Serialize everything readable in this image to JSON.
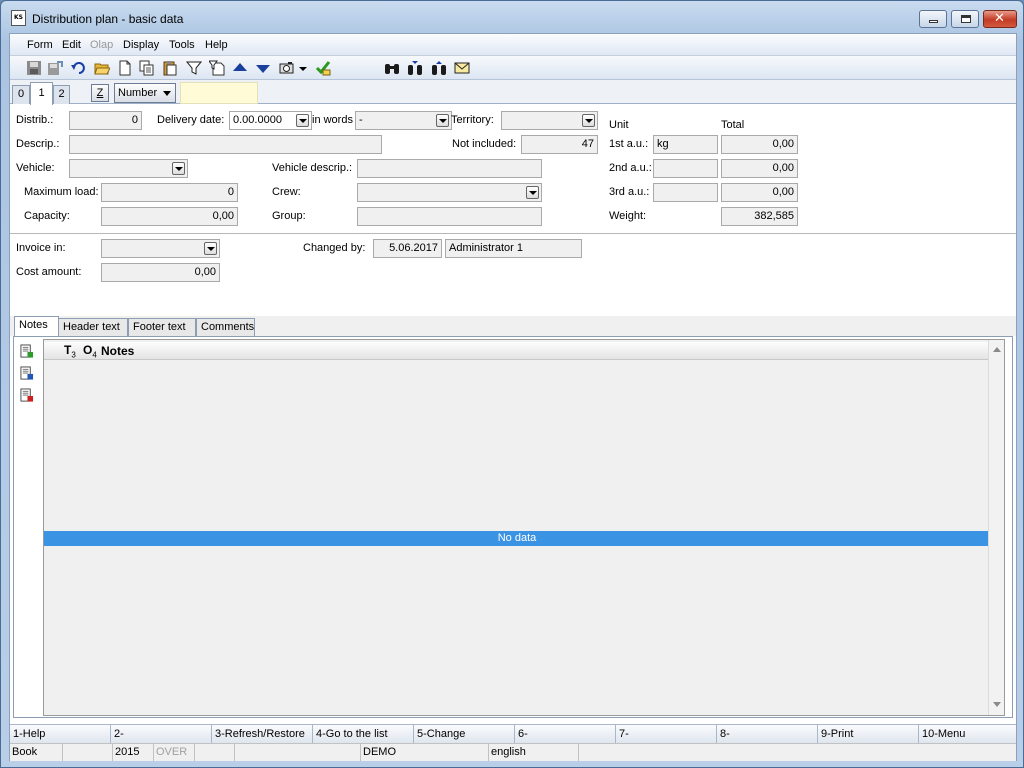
{
  "window": {
    "title": "Distribution plan - basic data",
    "app_icon_text": "KS"
  },
  "menu": [
    {
      "label": "Form",
      "enabled": true
    },
    {
      "label": "Edit",
      "enabled": true
    },
    {
      "label": "Olap",
      "enabled": false
    },
    {
      "label": "Display",
      "enabled": true
    },
    {
      "label": "Tools",
      "enabled": true
    },
    {
      "label": "Help",
      "enabled": true
    }
  ],
  "toolbar_icons": [
    "save-icon",
    "save-as-icon",
    "undo-icon",
    "open-folder-icon",
    "new-document-icon",
    "copy-icon",
    "paste-icon",
    "filter-icon",
    "filter-document-icon",
    "arrow-up-icon",
    "arrow-down-icon",
    "camera-icon",
    "dropdown-icon",
    "check-export-icon",
    "binoculars-icon",
    "binoculars-next-icon",
    "binoculars-prev-icon",
    "envelope-icon"
  ],
  "view_tabs": [
    "0",
    "1",
    "2"
  ],
  "active_view_tab": "1",
  "z_label": "Z",
  "search_mode": "Number",
  "search_value": "",
  "form": {
    "distrib_label": "Distrib.:",
    "distrib_value": "0",
    "delivery_date_label": "Delivery date:",
    "delivery_date_value": "0.00.0000",
    "in_words_label": "in words",
    "in_words_value": "-",
    "territory_label": "Territory:",
    "territory_value": "",
    "descrip_label": "Descrip.:",
    "descrip_value": "",
    "not_included_label": "Not included:",
    "not_included_value": "47",
    "vehicle_label": "Vehicle:",
    "vehicle_value": "",
    "vehicle_descrip_label": "Vehicle descrip.:",
    "vehicle_descrip_value": "",
    "max_load_label": "Maximum load:",
    "max_load_value": "0",
    "crew_label": "Crew:",
    "crew_value": "",
    "capacity_label": "Capacity:",
    "capacity_value": "0,00",
    "group_label": "Group:",
    "group_value": "",
    "unit_header": "Unit",
    "total_header": "Total",
    "au1_label": "1st a.u.:",
    "au1_unit": "kg",
    "au1_total": "0,00",
    "au2_label": "2nd a.u.:",
    "au2_unit": "",
    "au2_total": "0,00",
    "au3_label": "3rd a.u.:",
    "au3_unit": "",
    "au3_total": "0,00",
    "weight_label": "Weight:",
    "weight_value": "382,585",
    "invoice_in_label": "Invoice in:",
    "invoice_in_value": "",
    "cost_amount_label": "Cost amount:",
    "cost_amount_value": "0,00",
    "changed_by_label": "Changed by:",
    "changed_date": "5.06.2017",
    "changed_user": "Administrator 1"
  },
  "notes_tabs": [
    "Notes",
    "Header text",
    "Footer text",
    "Comments"
  ],
  "active_notes_tab": "Notes",
  "grid": {
    "col_icon1": "T",
    "col_sub1": "3",
    "col_icon2": "O",
    "col_sub2": "4",
    "col_notes": "Notes",
    "empty_text": "No data"
  },
  "side_icons": [
    "add-row-icon",
    "edit-row-icon",
    "delete-row-icon"
  ],
  "function_keys": [
    "1-Help",
    "2-",
    "3-Refresh/Restore",
    "4-Go to the list",
    "5-Change",
    "6-",
    "7-",
    "8-",
    "9-Print",
    "10-Menu"
  ],
  "status_bar": {
    "module": "Book",
    "year": "2015",
    "mode": "OVER",
    "database": "DEMO",
    "language": "english"
  }
}
